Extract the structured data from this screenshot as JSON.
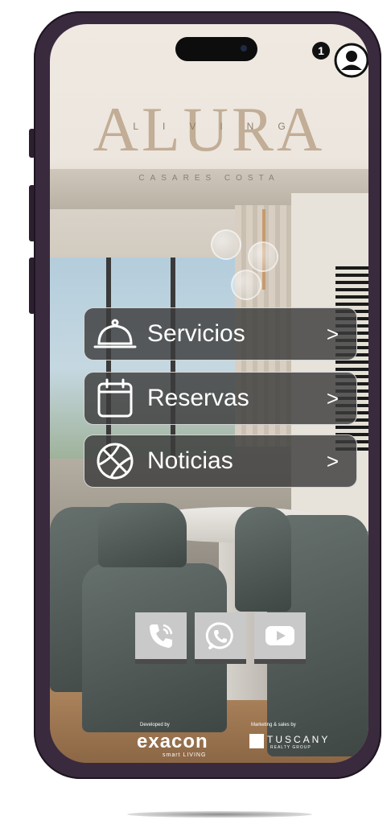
{
  "status": {
    "notification_count": "1",
    "profile_icon": "user-circle-icon"
  },
  "logo": {
    "main": "ALURA",
    "living": "LIVING",
    "sub": "CASARES COSTA"
  },
  "menu": [
    {
      "label": "Servicios",
      "arrow": ">",
      "icon": "service-bell-icon"
    },
    {
      "label": "Reservas",
      "arrow": ">",
      "icon": "calendar-icon"
    },
    {
      "label": "Noticias",
      "arrow": ">",
      "icon": "basketball-icon"
    }
  ],
  "social": [
    {
      "icon": "phone-call-icon"
    },
    {
      "icon": "whatsapp-icon"
    },
    {
      "icon": "youtube-icon"
    }
  ],
  "footer": {
    "developed_by": "Developed by",
    "developer": "exacon",
    "developer_sub": "smart LIVING",
    "marketing_by": "Marketing & sales by",
    "agency": "TUSCANY",
    "agency_sub": "REALTY GROUP"
  },
  "colors": {
    "logo": "#c2ad96",
    "button_bg": "#3c3c3c",
    "frame": "#3a2a3e"
  }
}
